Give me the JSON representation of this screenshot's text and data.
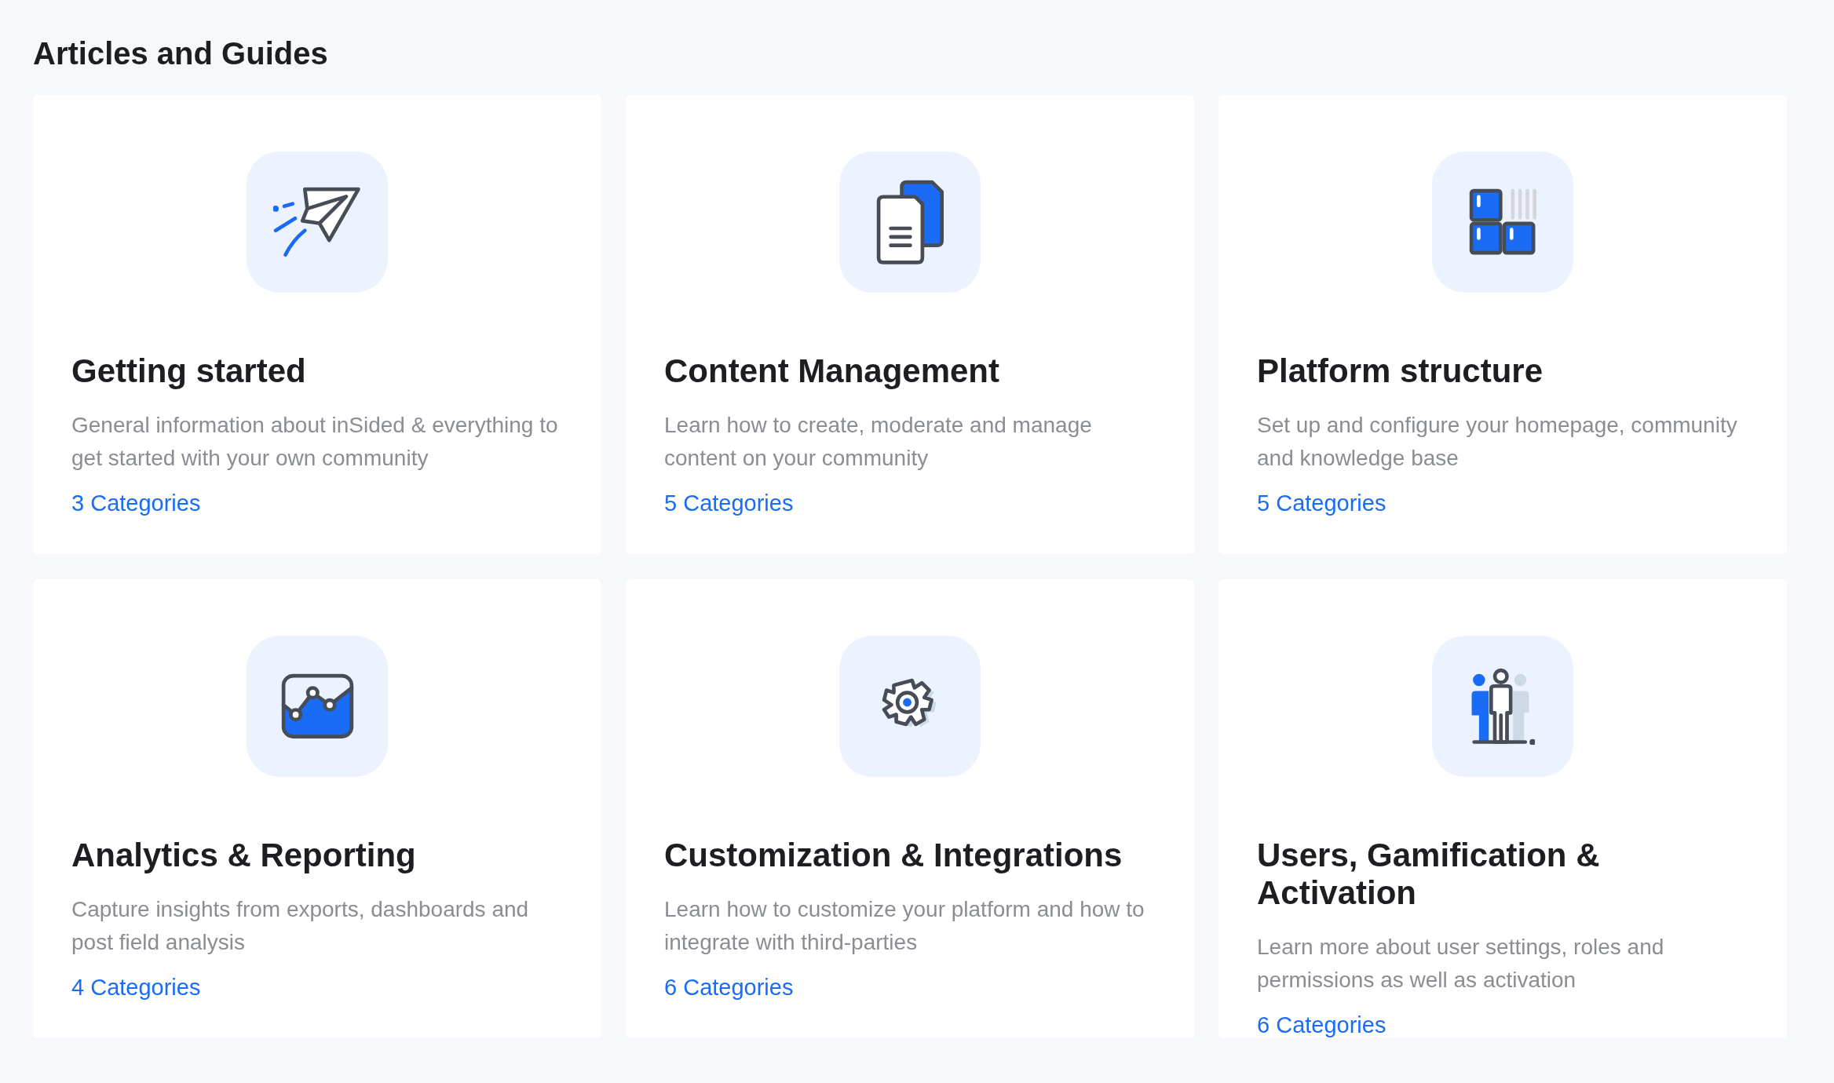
{
  "heading": "Articles and Guides",
  "cards": [
    {
      "kind": "paper-plane",
      "title": "Getting started",
      "description": "General information about inSided & everything to get started with your own community",
      "link": "3 Categories"
    },
    {
      "kind": "documents",
      "title": "Content Management",
      "description": "Learn how to create, moderate and manage content on your community",
      "link": "5 Categories"
    },
    {
      "kind": "blocks",
      "title": "Platform structure",
      "description": "Set up and configure your homepage, community and knowledge base",
      "link": "5 Categories"
    },
    {
      "kind": "chart",
      "title": "Analytics & Reporting",
      "description": "Capture insights from exports, dashboards and post field analysis",
      "link": "4 Categories"
    },
    {
      "kind": "gear",
      "title": "Customization & Integrations",
      "description": "Learn how to customize your platform and how to integrate with third-parties",
      "link": "6 Categories"
    },
    {
      "kind": "users",
      "title": "Users, Gamification & Activation",
      "description": "Learn more about user settings, roles and permissions as well as activation",
      "link": "6 Categories"
    }
  ]
}
